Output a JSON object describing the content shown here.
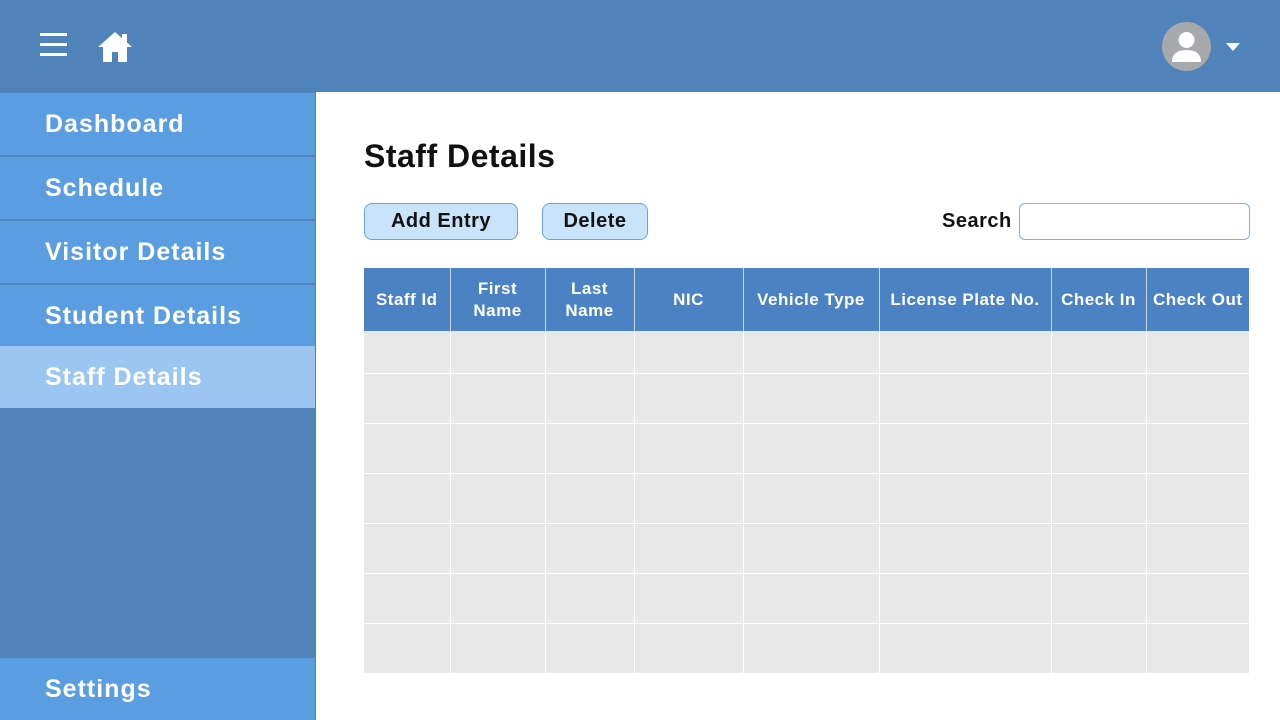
{
  "header": {
    "menu_icon": "hamburger-menu-icon",
    "home_icon": "home-icon",
    "avatar_icon": "user-avatar-icon",
    "dropdown_icon": "caret-down-icon"
  },
  "sidebar": {
    "items": [
      {
        "label": "Dashboard"
      },
      {
        "label": "Schedule"
      },
      {
        "label": "Visitor Details"
      },
      {
        "label": "Student Details"
      },
      {
        "label": "Staff Details",
        "active": true
      }
    ],
    "settings_label": "Settings"
  },
  "main": {
    "title": "Staff Details",
    "add_button": "Add Entry",
    "delete_button": "Delete",
    "search_label": "Search",
    "search_value": "",
    "table": {
      "columns": [
        "Staff Id",
        "First Name",
        "Last Name",
        "NIC",
        "Vehicle Type",
        "License Plate No.",
        "Check In",
        "Check Out"
      ],
      "rows": [
        [
          "",
          "",
          "",
          "",
          "",
          "",
          "",
          ""
        ],
        [
          "",
          "",
          "",
          "",
          "",
          "",
          "",
          ""
        ],
        [
          "",
          "",
          "",
          "",
          "",
          "",
          "",
          ""
        ],
        [
          "",
          "",
          "",
          "",
          "",
          "",
          "",
          ""
        ],
        [
          "",
          "",
          "",
          "",
          "",
          "",
          "",
          ""
        ],
        [
          "",
          "",
          "",
          "",
          "",
          "",
          "",
          ""
        ],
        [
          "",
          "",
          "",
          "",
          "",
          "",
          "",
          ""
        ]
      ]
    }
  },
  "colors": {
    "topbar": "#4f83b9",
    "nav_item": "#5a9de0",
    "nav_active": "#9ac6f1",
    "table_header": "#4a82c4",
    "table_cell": "#e8e8e8"
  }
}
